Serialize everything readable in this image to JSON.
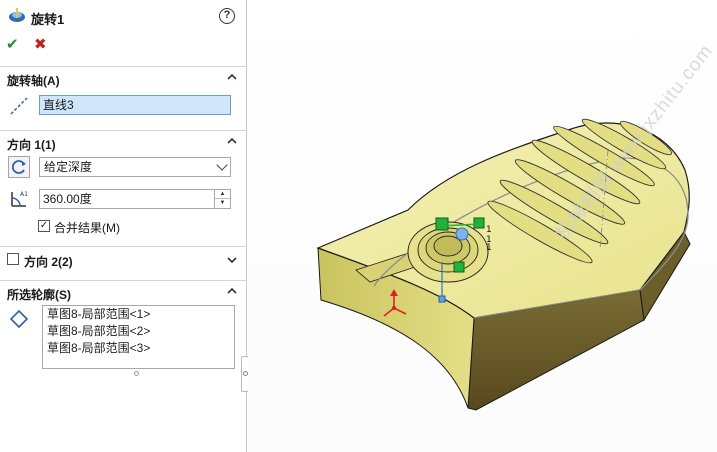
{
  "feature": {
    "title": "旋转1",
    "icon": "revolve-icon",
    "help_label": "?"
  },
  "actions": {
    "ok_icon": "checkmark-icon",
    "cancel_icon": "x-icon",
    "ok_symbol": "✔",
    "cancel_symbol": "✖"
  },
  "axis_section": {
    "title": "旋转轴(A)",
    "value": "直线3"
  },
  "direction1": {
    "title": "方向 1(1)",
    "end_condition": "给定深度",
    "angle": "360.00度",
    "merge_label": "合并结果(M)",
    "merge_checked": true
  },
  "direction2": {
    "title": "方向 2(2)",
    "checked": false
  },
  "contours": {
    "title": "所选轮廓(S)",
    "items": [
      "草图8-局部范围<1>",
      "草图8-局部范围<2>",
      "草图8-局部范围<3>"
    ]
  },
  "viewport": {
    "watermark": "机械制图 www.jxzhitu.com",
    "part_color": "#eeea9c",
    "part_shadow": "#6b5e2a",
    "handle_colors": {
      "green": "#1fb33a",
      "red": "#e21f26",
      "blue": "#2a74c9"
    }
  }
}
